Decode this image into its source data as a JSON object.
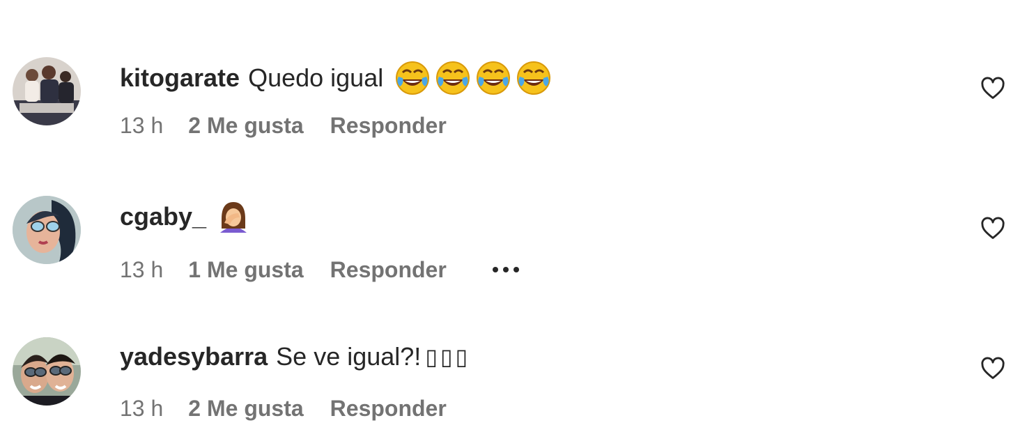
{
  "comments": [
    {
      "username": "kitogarate",
      "text": "Quedo igual",
      "emojis": [
        "face-with-tears-of-joy",
        "face-with-tears-of-joy",
        "face-with-tears-of-joy",
        "face-with-tears-of-joy"
      ],
      "time": "13 h",
      "likes": "2 Me gusta",
      "reply": "Responder"
    },
    {
      "username": "cgaby_",
      "text": "",
      "emojis": [
        "person-facepalming"
      ],
      "time": "13 h",
      "likes": "1 Me gusta",
      "reply": "Responder",
      "more_icon": "ellipsis-icon"
    },
    {
      "username": "yadesybarra",
      "text": "Se ve igual?!",
      "unrendered_glyphs": "▯▯▯",
      "time": "13 h",
      "likes": "2 Me gusta",
      "reply": "Responder"
    }
  ],
  "icons": {
    "like": "heart-outline-icon"
  },
  "colors": {
    "primary_text": "#262626",
    "secondary_text": "#737373",
    "background": "#ffffff"
  }
}
